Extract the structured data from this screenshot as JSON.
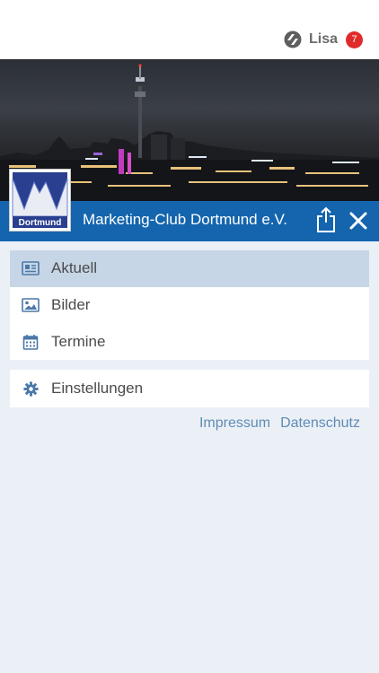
{
  "header": {
    "user_name": "Lisa",
    "notification_count": "7",
    "user_logo_icon": "app-logo-icon"
  },
  "club": {
    "title": "Marketing-Club Dortmund e.V.",
    "logo_text": "Dortmund",
    "brand_color": "#1465ae",
    "share_icon": "share-icon",
    "close_icon": "close-icon"
  },
  "menu": {
    "items": [
      {
        "label": "Aktuell",
        "icon": "news-icon",
        "active": true
      },
      {
        "label": "Bilder",
        "icon": "image-icon",
        "active": false
      },
      {
        "label": "Termine",
        "icon": "calendar-icon",
        "active": false
      }
    ],
    "settings": {
      "label": "Einstellungen",
      "icon": "gear-icon"
    }
  },
  "footer_links": {
    "impressum": "Impressum",
    "datenschutz": "Datenschutz"
  },
  "colors": {
    "background": "#ebf0f7",
    "active_item": "#c7d6e6",
    "link": "#5f8bb3",
    "badge": "#e02b2b"
  }
}
